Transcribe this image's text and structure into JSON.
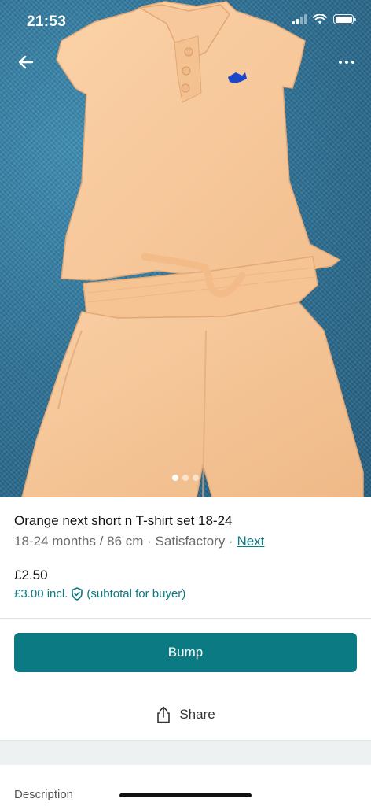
{
  "status_bar": {
    "time": "21:53"
  },
  "photo": {
    "page_count": 3,
    "active_page": 1
  },
  "listing": {
    "title": "Orange next short n T-shirt set 18-24",
    "meta": "18-24 months / 86 cm · Satisfactory · ",
    "brand": "Next",
    "price": "£2.50",
    "price_incl": "£3.00 incl.",
    "price_incl_note": "(subtotal for buyer)"
  },
  "actions": {
    "bump_label": "Bump",
    "share_label": "Share"
  },
  "description": {
    "label": "Description"
  },
  "colors": {
    "accent": "#0b7a82",
    "carpet": "#2f7499",
    "garment": "#f6c79a"
  },
  "icons": [
    "back-arrow-icon",
    "more-icon",
    "shield-check-icon",
    "share-icon"
  ]
}
